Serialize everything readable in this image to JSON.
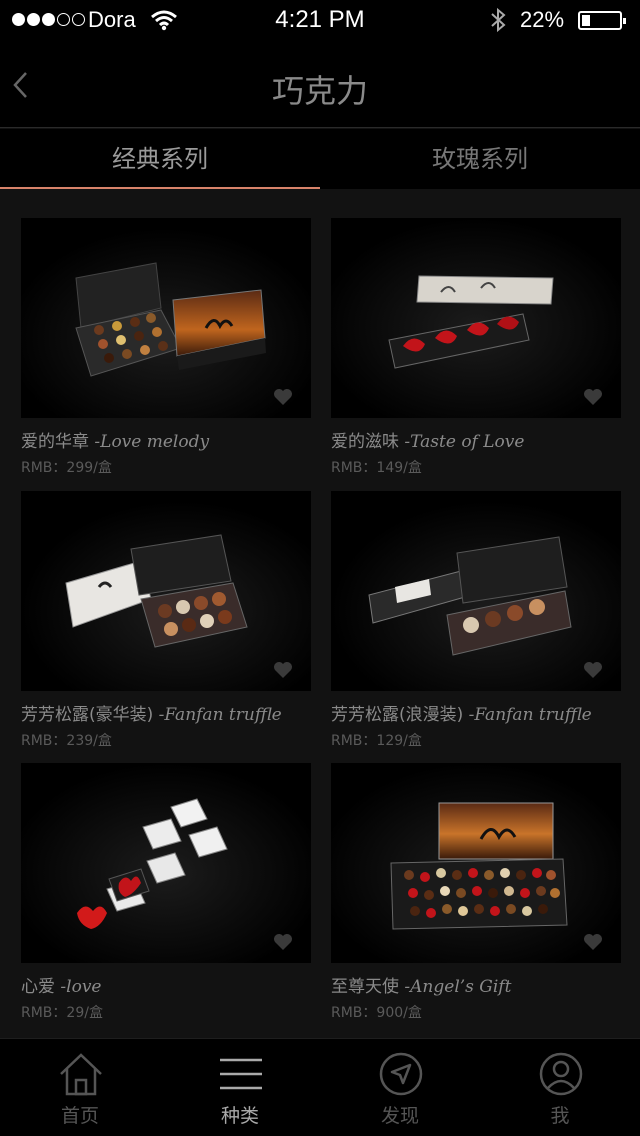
{
  "status_bar": {
    "carrier": "Dora",
    "time": "4:21 PM",
    "battery": "22%",
    "signal_bars": 3,
    "battery_level": 0.22
  },
  "nav": {
    "title": "巧克力",
    "back_icon": "chevron-left-icon"
  },
  "tabs": [
    {
      "label": "经典系列",
      "active": true
    },
    {
      "label": "玫瑰系列",
      "active": false
    }
  ],
  "products": [
    {
      "name_cn": "爱的华章",
      "name_en": "-Love melody",
      "price": "RMB：299/盒",
      "image": "nine-piece-chocolate-box"
    },
    {
      "name_cn": "爱的滋味",
      "name_en": "-Taste of Love",
      "price": "RMB：149/盒",
      "image": "heart-chocolate-bar-box"
    },
    {
      "name_cn": "芳芳松露(豪华装)",
      "name_en": "-Fanfan truffle",
      "price": "RMB：239/盒",
      "image": "truffle-deluxe-box"
    },
    {
      "name_cn": "芳芳松露(浪漫装)",
      "name_en": "-Fanfan truffle",
      "price": "RMB：129/盒",
      "image": "truffle-romance-box"
    },
    {
      "name_cn": "心爱",
      "name_en": "-love",
      "price": "RMB：29/盒",
      "image": "stacked-cube-boxes"
    },
    {
      "name_cn": "至尊天使",
      "name_en": "-Angel’s Gift",
      "price": "RMB：900/盒",
      "image": "large-assorted-tin"
    }
  ],
  "tab_bar": [
    {
      "label": "首页",
      "icon": "home-icon",
      "active": false
    },
    {
      "label": "种类",
      "icon": "menu-icon",
      "active": true
    },
    {
      "label": "发现",
      "icon": "compass-icon",
      "active": false
    },
    {
      "label": "我",
      "icon": "user-icon",
      "active": false
    }
  ],
  "colors": {
    "accent": "#d8836a",
    "background": "#121212",
    "bar": "#000000"
  }
}
